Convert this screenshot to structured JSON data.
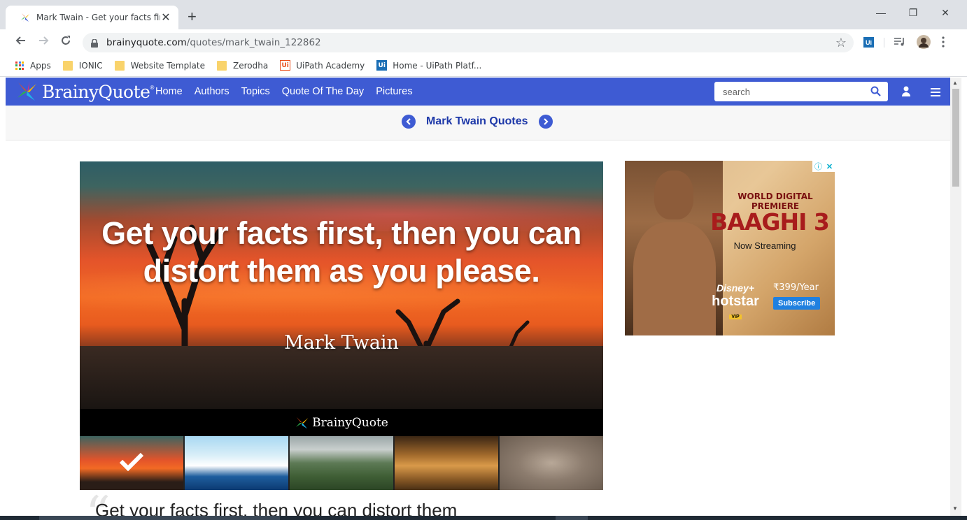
{
  "browser": {
    "tab_title": "Mark Twain - Get your facts first,",
    "tab_close": "✕",
    "new_tab": "+",
    "window_controls": {
      "minimize": "—",
      "restore": "❐",
      "close": "✕"
    },
    "url_host": "brainyquote.com",
    "url_path": "/quotes/mark_twain_122862",
    "bookmarks": [
      {
        "label": "Apps",
        "icon": "apps-grid-icon"
      },
      {
        "label": "IONIC",
        "icon": "folder-icon"
      },
      {
        "label": "Website Template",
        "icon": "folder-icon"
      },
      {
        "label": "Zerodha",
        "icon": "folder-icon"
      },
      {
        "label": "UiPath Academy",
        "icon": "uipath-icon"
      },
      {
        "label": "Home - UiPath Platf...",
        "icon": "uipath-icon"
      }
    ]
  },
  "site": {
    "logo_text": "BrainyQuote",
    "logo_mark": "®",
    "nav": [
      "Home",
      "Authors",
      "Topics",
      "Quote Of The Day",
      "Pictures"
    ],
    "search_placeholder": "search",
    "subnav_title": "Mark Twain Quotes"
  },
  "quote": {
    "text": "Get your facts first, then you can distort them as you please.",
    "author": "Mark Twain",
    "brand_caption": "BrainyQuote",
    "cut_text": "Get your facts first, then you can distort them"
  },
  "ad": {
    "line1": "WORLD DIGITAL PREMIERE",
    "title": "BAAGHI 3",
    "streaming": "Now Streaming",
    "brand_disney": "Disney+",
    "brand_hotstar": "hotstar",
    "brand_vip": "VIP",
    "price": "₹399/Year",
    "subscribe": "Subscribe"
  },
  "colors": {
    "nav_blue": "#3e5bd3",
    "subnav_title": "#1c37a8"
  }
}
